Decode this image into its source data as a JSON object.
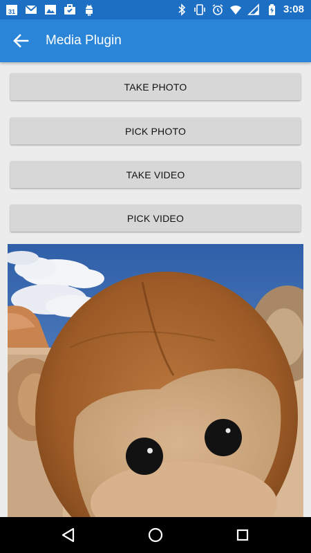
{
  "status_bar": {
    "time": "3:08",
    "calendar_day": "31",
    "left_icons": [
      "calendar-icon",
      "gmail-icon",
      "image-icon",
      "briefcase-icon",
      "android-icon"
    ],
    "right_icons": [
      "bluetooth-icon",
      "vibrate-icon",
      "alarm-icon",
      "wifi-icon",
      "signal-icon",
      "battery-charging-icon"
    ]
  },
  "app_bar": {
    "title": "Media Plugin",
    "back_icon": "arrow-back-icon"
  },
  "buttons": {
    "take_photo": "TAKE PHOTO",
    "pick_photo": "PICK PHOTO",
    "take_video": "TAKE VIDEO",
    "pick_video": "PICK VIDEO"
  },
  "nav_bar": {
    "back": "back-triangle-icon",
    "home": "home-circle-icon",
    "recents": "recents-square-icon"
  },
  "colors": {
    "status_bar": "#1d6fc4",
    "app_bar": "#2a85d8",
    "button": "#d7d7d7",
    "background": "#ececec"
  }
}
